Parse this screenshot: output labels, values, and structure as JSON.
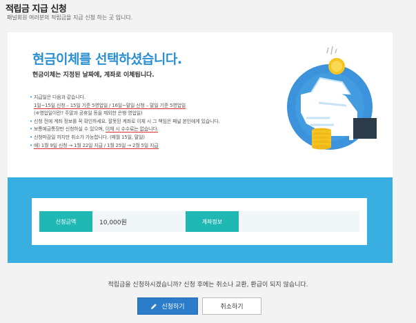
{
  "header": {
    "title": "적립금 지급 신청",
    "subtitle": "패널회원 여러분의 적립금을 지급 신청 하는 곳 입니다."
  },
  "card": {
    "headline": "현금이체를 선택하셨습니다.",
    "subhead": "현금이체는 지정된 날짜에, 계좌로 이체됩니다.",
    "notes": [
      "지급일은 다음과 같습니다.",
      "1일~15일 신청 – 15일 기준 5영업일 / 16일~말일 신청 – 말일 기준 5영업일",
      "(※영업일이란? 주말과 공휴일 등을 제외한 은행 영업일)",
      "신청 전에 계좌 정보를 꼭 확인하세요. 잘못된 계좌로 이체 시 그 책임은 패널 본인에게 있습니다.",
      "보통예금통장만 신청하실 수 있으며,",
      "이체 시 수수료는 없습니다.",
      "신청마감일 까지만 취소가 가능합니다. (매월 15일, 말일)",
      "예) 1월 9일 신청 → 1월 22일 지급 / 1월 25일 → 2월 5일 지급"
    ]
  },
  "info": {
    "amount_label": "신청금액",
    "amount_value": "10,000원",
    "account_label": "계좌정보",
    "account_value": ""
  },
  "footer": {
    "confirm_text": "적립금을 신청하시겠습니까? 신청 후에는 취소나 교환, 환급이 되지 않습니다.",
    "apply_label": "신청하기",
    "cancel_label": "취소하기"
  },
  "colors": {
    "accent_blue": "#2a8fd0",
    "panel_blue": "#39aee0",
    "teal": "#20b8b2",
    "underline_red": "#e0282f"
  }
}
